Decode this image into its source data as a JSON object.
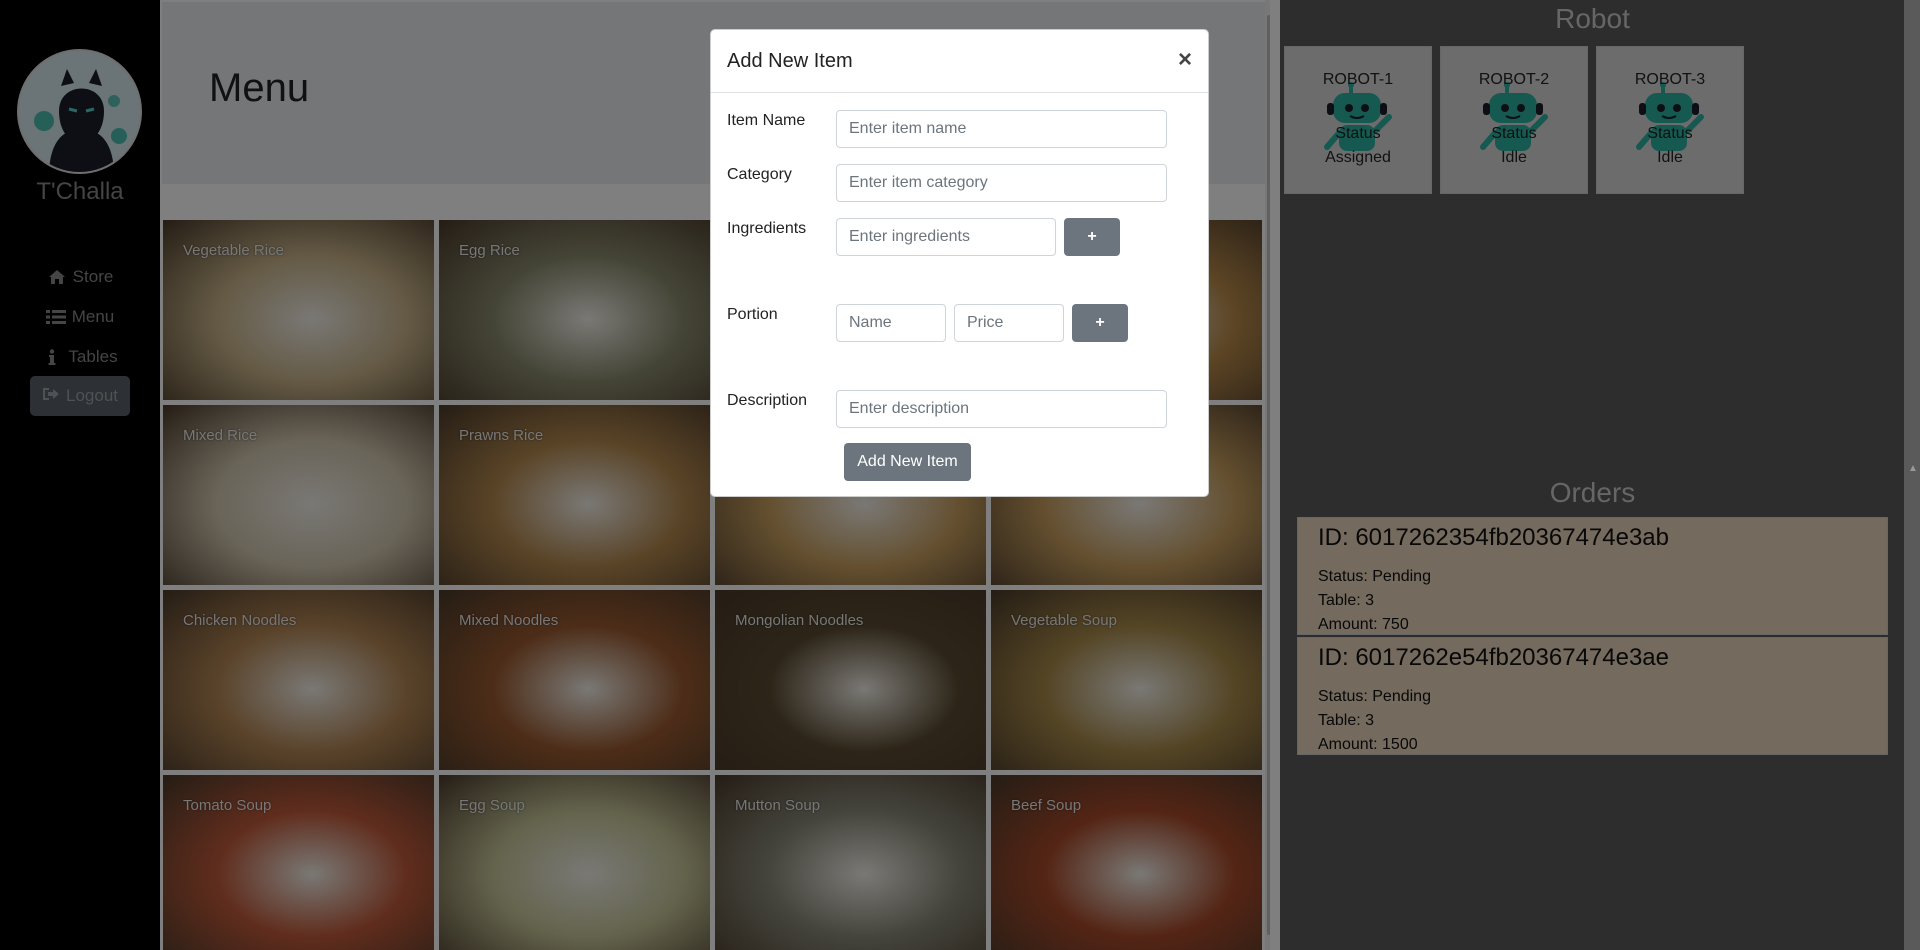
{
  "sidebar": {
    "username": "T'Challa",
    "nav": [
      {
        "label": "Store",
        "icon": "home-icon"
      },
      {
        "label": "Menu",
        "icon": "list-icon"
      },
      {
        "label": "Tables",
        "icon": "info-icon"
      }
    ],
    "logout_label": "Logout"
  },
  "main": {
    "title": "Menu",
    "items": [
      {
        "label": "Vegetable Rice",
        "color": "#c9b48a"
      },
      {
        "label": "Egg Rice",
        "color": "#8a8a6e"
      },
      {
        "label": "",
        "color": "#b99a6a"
      },
      {
        "label": "",
        "color": "#b98a4a"
      },
      {
        "label": "Mixed Rice",
        "color": "#d4c9b2"
      },
      {
        "label": "Prawns Rice",
        "color": "#b4884e"
      },
      {
        "label": "",
        "color": "#c9a060"
      },
      {
        "label": "",
        "color": "#c9a060"
      },
      {
        "label": "Chicken Noodles",
        "color": "#b48654"
      },
      {
        "label": "Mixed Noodles",
        "color": "#9a5a30"
      },
      {
        "label": "Mongolian Noodles",
        "color": "#5a4a30"
      },
      {
        "label": "Vegetable Soup",
        "color": "#a88a4a"
      },
      {
        "label": "Tomato Soup",
        "color": "#c05a3a"
      },
      {
        "label": "Egg Soup",
        "color": "#c8c89a"
      },
      {
        "label": "Mutton Soup",
        "color": "#8a8a7a"
      },
      {
        "label": "Beef Soup",
        "color": "#a84a2a"
      }
    ]
  },
  "robots": {
    "title": "Robot",
    "status_label": "Status",
    "items": [
      {
        "name": "ROBOT-1",
        "status": "Assigned"
      },
      {
        "name": "ROBOT-2",
        "status": "Idle"
      },
      {
        "name": "ROBOT-3",
        "status": "Idle"
      }
    ]
  },
  "orders": {
    "title": "Orders",
    "items": [
      {
        "id": "ID: 6017262354fb20367474e3ab",
        "status": "Status: Pending",
        "table": "Table: 3",
        "amount": "Amount: 750"
      },
      {
        "id": "ID: 6017262e54fb20367474e3ae",
        "status": "Status: Pending",
        "table": "Table: 3",
        "amount": "Amount: 1500"
      }
    ]
  },
  "modal": {
    "title": "Add New Item",
    "close": "×",
    "item_name_label": "Item Name",
    "item_name_placeholder": "Enter item name",
    "category_label": "Category",
    "category_placeholder": "Enter item category",
    "ingredients_label": "Ingredients",
    "ingredients_placeholder": "Enter ingredients",
    "plus": "+",
    "portion_label": "Portion",
    "portion_name_placeholder": "Name",
    "portion_price_placeholder": "Price",
    "description_label": "Description",
    "description_placeholder": "Enter description",
    "submit_label": "Add New Item"
  },
  "colors": {
    "sidebar_bg": "#000000",
    "order_card_bg": "#e8d5ba",
    "robot_accent": "#2bb3a3",
    "button_gray": "#6c757d"
  }
}
